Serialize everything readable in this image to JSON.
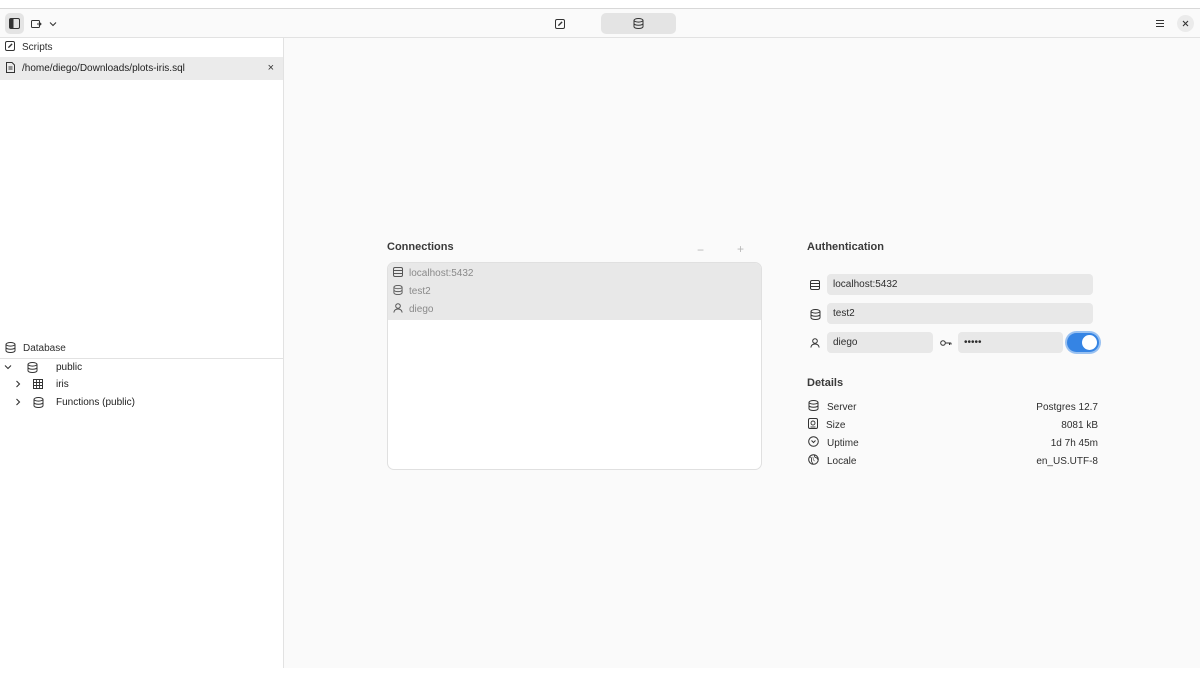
{
  "window": {
    "accent_color": "#3584e4"
  },
  "headerbar": {
    "left_icons": [
      "sidebar-toggle-icon",
      "script-new-icon",
      "chevron-down-icon"
    ],
    "center_tabs": [
      {
        "icon": "edit-icon",
        "active": false
      },
      {
        "icon": "database-icon",
        "active": true
      }
    ],
    "right_icons": [
      "menu-icon",
      "close-icon"
    ]
  },
  "sidebar": {
    "scripts_header": "Scripts",
    "scripts": [
      {
        "path": "/home/diego/Downloads/plots-iris.sql",
        "close": "×"
      }
    ],
    "database_header": "Database",
    "tree": [
      {
        "label": "public",
        "icon": "database-icon",
        "expanded": true,
        "level": 0
      },
      {
        "label": "iris",
        "icon": "table-icon",
        "expanded": false,
        "level": 1
      },
      {
        "label": "Functions (public)",
        "icon": "database-icon",
        "expanded": false,
        "level": 1
      }
    ]
  },
  "connections": {
    "title": "Connections",
    "remove_label": "−",
    "add_label": "+",
    "items": [
      {
        "label": "localhost:5432",
        "icon": "server-icon"
      },
      {
        "label": "test2",
        "icon": "database-icon"
      },
      {
        "label": "diego",
        "icon": "user-icon"
      }
    ]
  },
  "authentication": {
    "title": "Authentication",
    "host": "localhost:5432",
    "database": "test2",
    "user": "diego",
    "password": "•••••",
    "remember_enabled": true
  },
  "details": {
    "title": "Details",
    "rows": [
      {
        "label": "Server",
        "value": "Postgres 12.7",
        "icon": "database-icon"
      },
      {
        "label": "Size",
        "value": "8081 kB",
        "icon": "disk-icon"
      },
      {
        "label": "Uptime",
        "value": "1d 7h 45m",
        "icon": "clock-icon"
      },
      {
        "label": "Locale",
        "value": "en_US.UTF-8",
        "icon": "globe-icon"
      }
    ]
  }
}
